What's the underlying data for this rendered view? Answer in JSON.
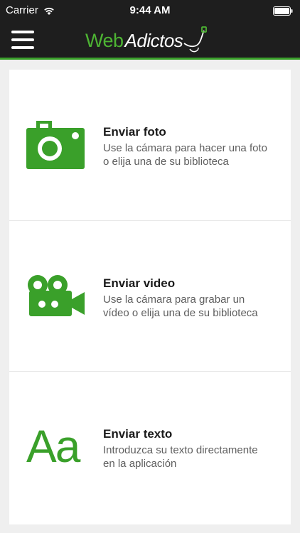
{
  "status": {
    "carrier": "Carrier",
    "time": "9:44 AM"
  },
  "header": {
    "logo_primary": "Web",
    "logo_secondary": "Adictos"
  },
  "options": [
    {
      "icon": "camera-icon",
      "title": "Enviar foto",
      "desc_line1": "Use la cámara para hacer una foto",
      "desc_line2": "o elija una de su biblioteca"
    },
    {
      "icon": "video-camera-icon",
      "title": "Enviar video",
      "desc_line1": "Use la cámara para grabar un",
      "desc_line2": "vídeo o elija una de su biblioteca"
    },
    {
      "icon": "text-icon",
      "icon_text": "Aa",
      "title": "Enviar texto",
      "desc_line1": "Introduzca su texto directamente",
      "desc_line2": "en la aplicación"
    }
  ],
  "colors": {
    "accent": "#3aa02a",
    "bar": "#1e1e1e",
    "background": "#efefef"
  }
}
